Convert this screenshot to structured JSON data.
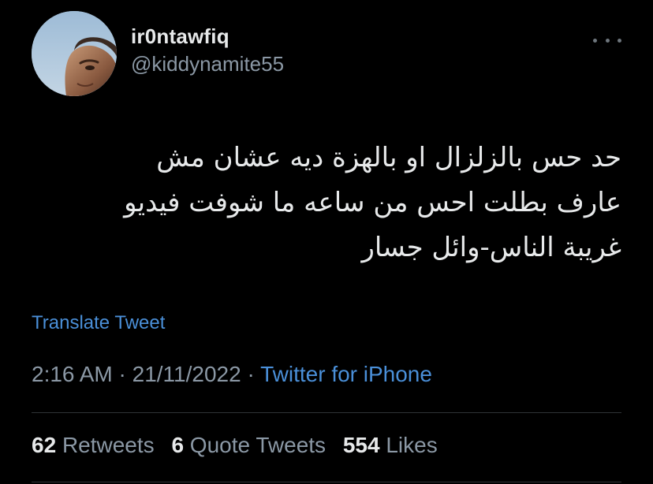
{
  "author": {
    "display_name": "ir0ntawfiq",
    "handle": "@kiddynamite55"
  },
  "icons": {
    "avatar": "profile-photo",
    "more": "more-horizontal-icon"
  },
  "tweet": {
    "text": "حد حس بالزلزال او بالهزة ديه عشان مش\nعارف بطلت احس من ساعه ما شوفت فيديو\nغريبة الناس-وائل جسار",
    "translate_label": "Translate Tweet",
    "time": "2:16 AM",
    "date": "21/11/2022",
    "separator": "·",
    "source": "Twitter for iPhone"
  },
  "stats": {
    "retweets_count": "62",
    "retweets_label": "Retweets",
    "quotes_count": "6",
    "quotes_label": "Quote Tweets",
    "likes_count": "554",
    "likes_label": "Likes"
  },
  "colors": {
    "background": "#000000",
    "primary_text": "#e7e9ea",
    "secondary_text": "#8b98a5",
    "link": "#4a8fd8",
    "divider": "#2f3336"
  }
}
